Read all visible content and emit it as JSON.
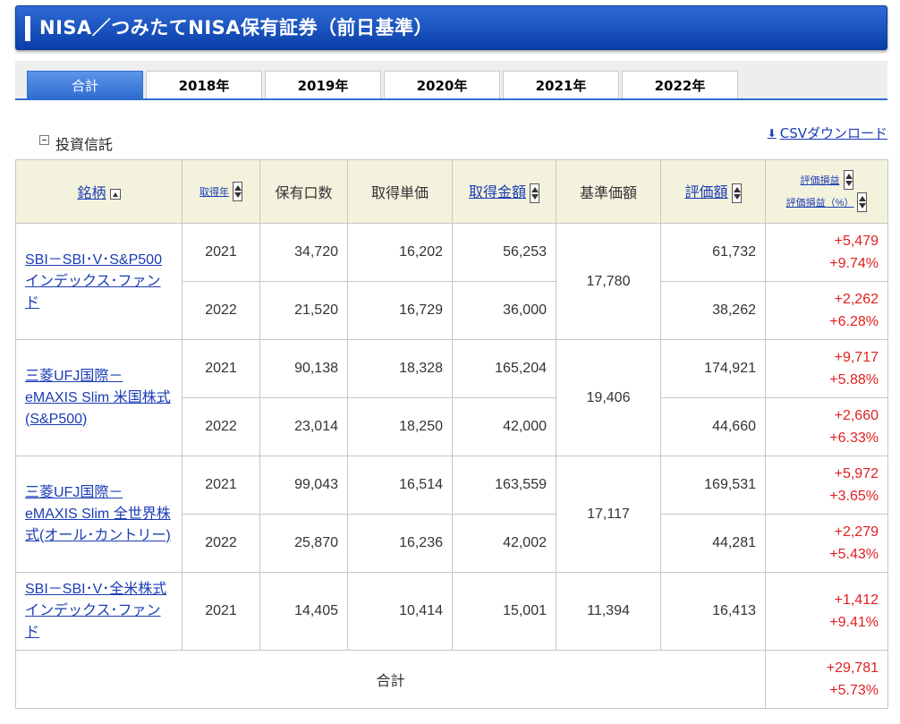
{
  "header": {
    "title": "NISA／つみたてNISA保有証券（前日基準）"
  },
  "tabs": [
    {
      "label": "合計",
      "active": true
    },
    {
      "label": "2018年",
      "active": false
    },
    {
      "label": "2019年",
      "active": false
    },
    {
      "label": "2020年",
      "active": false
    },
    {
      "label": "2021年",
      "active": false
    },
    {
      "label": "2022年",
      "active": false
    }
  ],
  "section": {
    "label": "投資信託",
    "csv_label": "CSVダウンロード"
  },
  "table": {
    "headers": {
      "name": "銘柄",
      "year": "取得年",
      "units": "保有口数",
      "unit_cost": "取得単価",
      "cost_amount": "取得金額",
      "nav": "基準価額",
      "valuation": "評価額",
      "gain": "評価損益",
      "gain_pct": "評価損益（%）"
    },
    "funds": [
      {
        "name": "SBI－SBI･V･S&P500インデックス･ファンド",
        "nav": "17,780",
        "rows": [
          {
            "year": "2021",
            "units": "34,720",
            "unit_cost": "16,202",
            "cost_amount": "56,253",
            "valuation": "61,732",
            "gain": "+5,479",
            "gain_pct": "+9.74%"
          },
          {
            "year": "2022",
            "units": "21,520",
            "unit_cost": "16,729",
            "cost_amount": "36,000",
            "valuation": "38,262",
            "gain": "+2,262",
            "gain_pct": "+6.28%"
          }
        ]
      },
      {
        "name": "三菱UFJ国際－eMAXIS Slim 米国株式(S&P500)",
        "nav": "19,406",
        "rows": [
          {
            "year": "2021",
            "units": "90,138",
            "unit_cost": "18,328",
            "cost_amount": "165,204",
            "valuation": "174,921",
            "gain": "+9,717",
            "gain_pct": "+5.88%"
          },
          {
            "year": "2022",
            "units": "23,014",
            "unit_cost": "18,250",
            "cost_amount": "42,000",
            "valuation": "44,660",
            "gain": "+2,660",
            "gain_pct": "+6.33%"
          }
        ]
      },
      {
        "name": "三菱UFJ国際－eMAXIS Slim 全世界株式(オール･カントリー)",
        "nav": "17,117",
        "rows": [
          {
            "year": "2021",
            "units": "99,043",
            "unit_cost": "16,514",
            "cost_amount": "163,559",
            "valuation": "169,531",
            "gain": "+5,972",
            "gain_pct": "+3.65%"
          },
          {
            "year": "2022",
            "units": "25,870",
            "unit_cost": "16,236",
            "cost_amount": "42,002",
            "valuation": "44,281",
            "gain": "+2,279",
            "gain_pct": "+5.43%"
          }
        ]
      },
      {
        "name": "SBI－SBI･V･全米株式インデックス･ファンド",
        "nav": "11,394",
        "rows": [
          {
            "year": "2021",
            "units": "14,405",
            "unit_cost": "10,414",
            "cost_amount": "15,001",
            "valuation": "16,413",
            "gain": "+1,412",
            "gain_pct": "+9.41%"
          }
        ]
      }
    ],
    "total": {
      "label": "合計",
      "gain": "+29,781",
      "gain_pct": "+5.73%"
    }
  }
}
